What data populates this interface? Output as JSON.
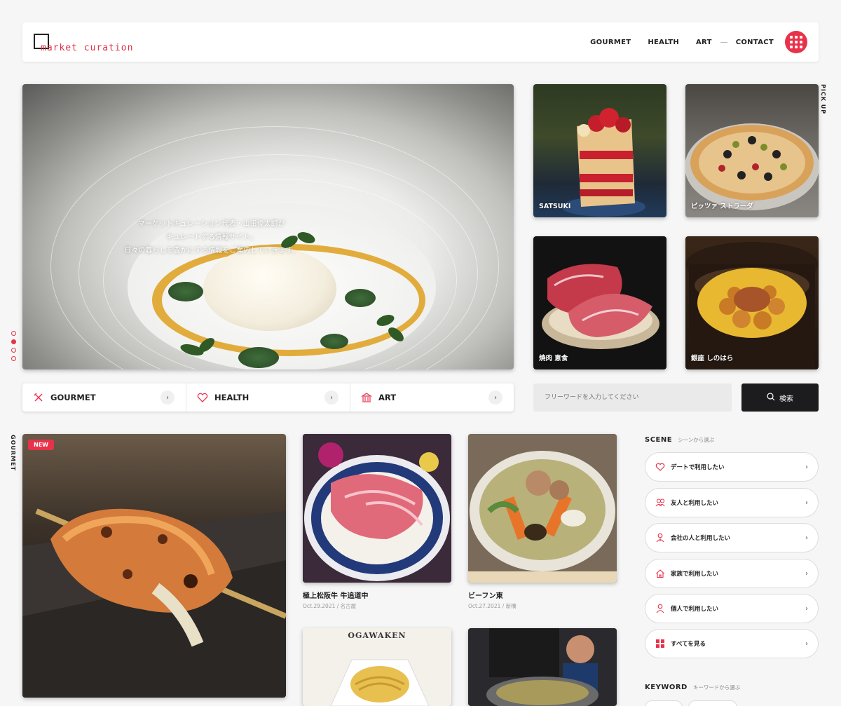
{
  "header": {
    "logo_text": "market curation",
    "nav": [
      "GOURMET",
      "HEALTH",
      "ART",
      "CONTACT"
    ]
  },
  "hero": {
    "caption_lines": [
      "マーケットキュレーション代表・山田俊太朗が",
      "キュレートする情報サイト。",
      "日々の暮らしを豊かにする情報をご案内していきます。"
    ],
    "slide_count": 4,
    "active_slide": 2
  },
  "pickup": {
    "title": "PICK UP",
    "items": [
      "SATSUKI",
      "ピッツァ ストラーダ",
      "焼肉 恵食",
      "銀座 しのはら"
    ]
  },
  "categories": [
    "GOURMET",
    "HEALTH",
    "ART"
  ],
  "search": {
    "placeholder": "フリーワードを入力してください",
    "button_label": "検索"
  },
  "gourmet": {
    "side_title": "GOURMET",
    "new_badge": "NEW",
    "cards": [
      {
        "title": "極上松阪牛 牛追道中",
        "meta": "Oct.29.2021 / 名古屋"
      },
      {
        "title": "ビーフン東",
        "meta": "Oct.27.2021 / 新橋"
      },
      {
        "sign": "OGAWAKEN"
      }
    ]
  },
  "scene": {
    "title": "SCENE",
    "subtitle": "シーンから選ぶ",
    "items": [
      "デートで利用したい",
      "友人と利用したい",
      "会社の人と利用したい",
      "家族で利用したい",
      "個人で利用したい",
      "すべてを見る"
    ]
  },
  "keyword": {
    "title": "KEYWORD",
    "subtitle": "キーワードから選ぶ"
  },
  "colors": {
    "accent": "#e8324a",
    "dark": "#1c1c1e",
    "background": "#f6f6f6"
  }
}
